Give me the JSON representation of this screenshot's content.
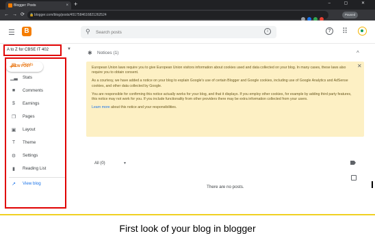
{
  "browser": {
    "tab_title": "Blogger: Posts",
    "tab_close": "×",
    "new_tab": "+",
    "url": "blogger.com/blog/posts/4517584616821262524",
    "profile_label": "Paused",
    "window_controls": "–  ▢  ✕"
  },
  "header": {
    "logo_letter": "B",
    "search_placeholder": "Search posts"
  },
  "sidebar": {
    "blog_name": "A to Z for CBSE IT 402",
    "new_post_label": "NEW POST",
    "items": [
      {
        "label": "Posts",
        "icon": "posts-icon"
      },
      {
        "label": "Stats",
        "icon": "stats-icon"
      },
      {
        "label": "Comments",
        "icon": "comments-icon"
      },
      {
        "label": "Earnings",
        "icon": "earnings-icon"
      },
      {
        "label": "Pages",
        "icon": "pages-icon"
      },
      {
        "label": "Layout",
        "icon": "layout-icon"
      },
      {
        "label": "Theme",
        "icon": "theme-icon"
      },
      {
        "label": "Settings",
        "icon": "gear-icon"
      },
      {
        "label": "Reading List",
        "icon": "bookmark-icon"
      },
      {
        "label": "View blog",
        "icon": "external-link-icon"
      }
    ]
  },
  "main": {
    "notices_title": "Notices (1)",
    "notice_paragraphs": [
      "European Union laws require you to give European Union visitors information about cookies used and data collected on your blog. In many cases, these laws also require you to obtain consent.",
      "As a courtesy, we have added a notice on your blog to explain Google's use of certain Blogger and Google cookies, including use of Google Analytics and AdSense cookies, and other data collected by Google.",
      "You are responsible for confirming this notice actually works for your blog, and that it displays. If you employ other cookies, for example by adding third party features, this notice may not work for you. If you include functionality from other providers there may be extra information collected from your users."
    ],
    "notice_link": "Learn more",
    "notice_link_suffix": " about this notice and your responsibilities.",
    "filter_label": "All (0)",
    "empty_message": "There are no posts."
  },
  "caption": "First look of your blog in blogger",
  "colors": {
    "accent": "#e8710a",
    "highlight_border": "#e00000",
    "notice_bg": "#fdf0c4",
    "link": "#1a73e8"
  }
}
